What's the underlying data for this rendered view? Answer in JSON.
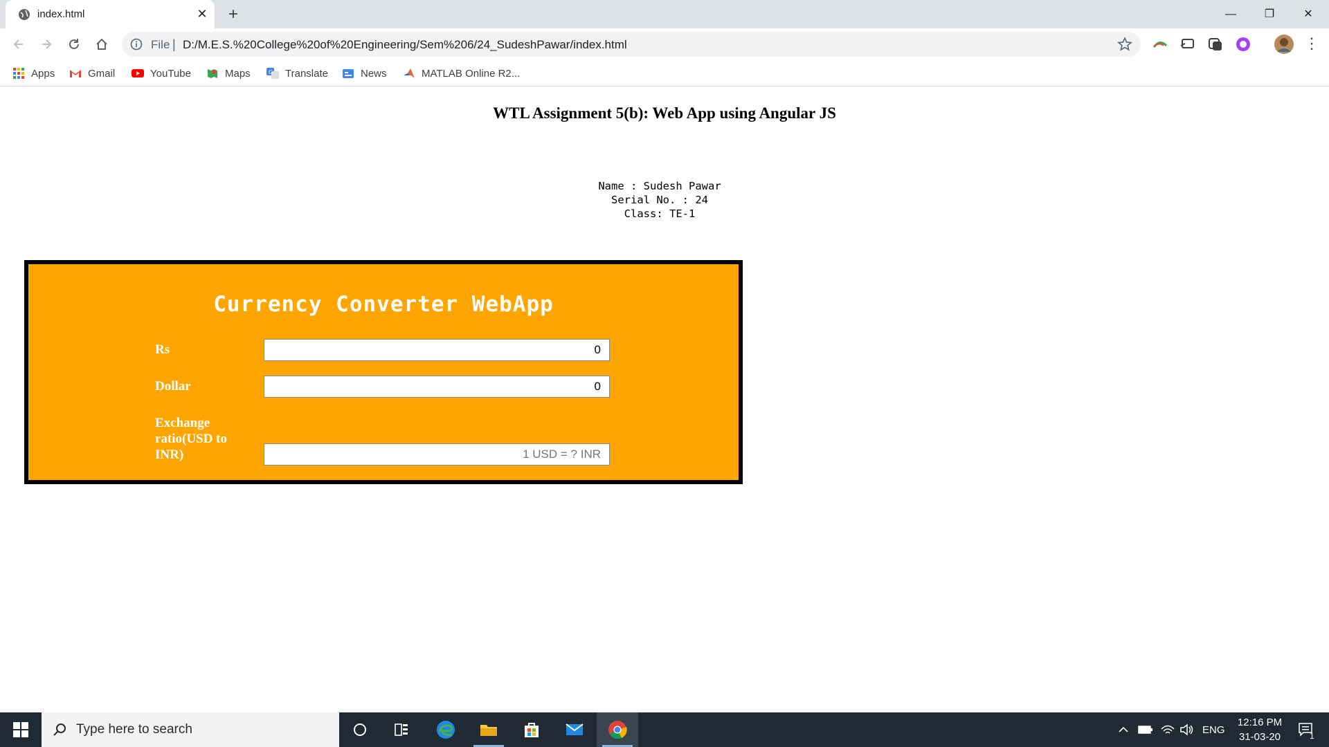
{
  "browser": {
    "tab_title": "index.html",
    "scheme_label": "File",
    "separator": "|",
    "url": "D:/M.E.S.%20College%20of%20Engineering/Sem%206/24_SudeshPawar/index.html",
    "bookmarks": [
      {
        "label": "Apps",
        "icon": "apps-grid-icon"
      },
      {
        "label": "Gmail",
        "icon": "gmail-icon"
      },
      {
        "label": "YouTube",
        "icon": "youtube-icon"
      },
      {
        "label": "Maps",
        "icon": "maps-icon"
      },
      {
        "label": "Translate",
        "icon": "translate-icon"
      },
      {
        "label": "News",
        "icon": "news-icon"
      },
      {
        "label": "MATLAB Online R2...",
        "icon": "matlab-icon"
      }
    ]
  },
  "page": {
    "title": "WTL Assignment 5(b): Web App using Angular JS",
    "info": {
      "name": "Name : Sudesh Pawar",
      "serial": "Serial No. : 24",
      "class": "Class: TE-1"
    },
    "converter": {
      "title": "Currency Converter WebApp",
      "rs_label": "Rs",
      "rs_value": "0",
      "dollar_label": "Dollar",
      "dollar_value": "0",
      "ratio_label": "Exchange ratio(USD to INR)",
      "ratio_value": "",
      "ratio_placeholder": "1 USD = ? INR"
    }
  },
  "taskbar": {
    "search_placeholder": "Type here to search",
    "language": "ENG",
    "time": "12:16 PM",
    "date": "31-03-20",
    "notification_count": "1"
  },
  "colors": {
    "converter_bg": "#ffa500",
    "converter_border": "#000000",
    "taskbar_bg": "#1f2a34"
  }
}
